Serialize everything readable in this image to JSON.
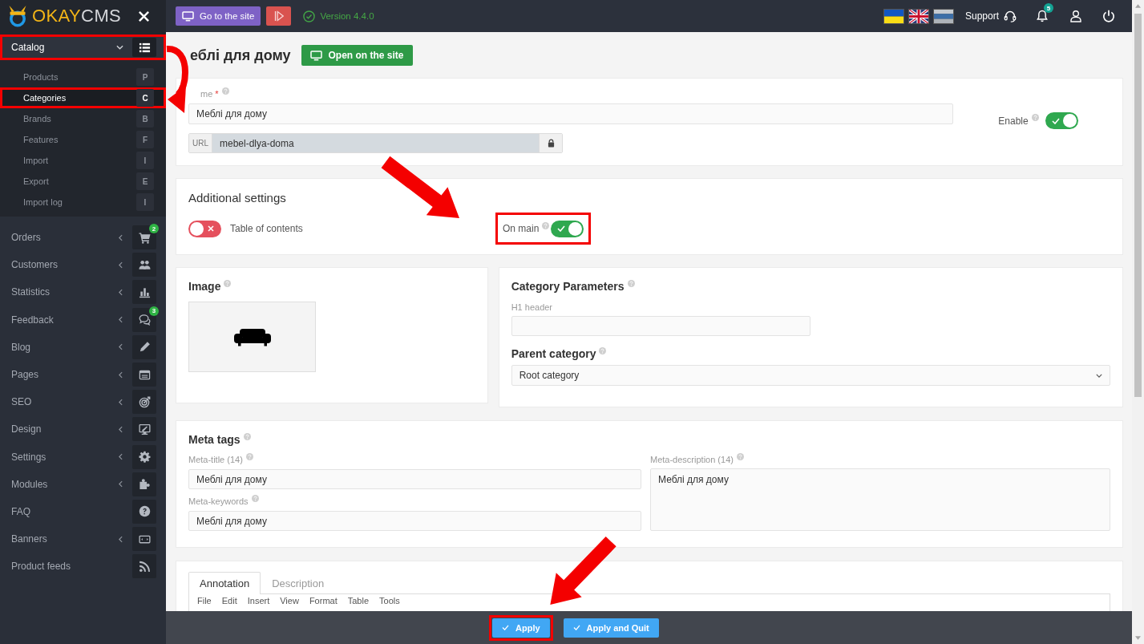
{
  "sidebar": {
    "logo": {
      "accent": "OKAY",
      "rest": "CMS"
    },
    "menu": [
      {
        "label": "Catalog",
        "kind": "group",
        "expanded": true,
        "highlighted": true,
        "children": [
          {
            "label": "Products",
            "shortcut": "P",
            "selected": false,
            "highlighted": false
          },
          {
            "label": "Categories",
            "shortcut": "C",
            "selected": true,
            "highlighted": true
          },
          {
            "label": "Brands",
            "shortcut": "B",
            "selected": false,
            "highlighted": false
          },
          {
            "label": "Features",
            "shortcut": "F",
            "selected": false,
            "highlighted": false
          },
          {
            "label": "Import",
            "shortcut": "I",
            "selected": false,
            "highlighted": false
          },
          {
            "label": "Export",
            "shortcut": "E",
            "selected": false,
            "highlighted": false
          },
          {
            "label": "Import log",
            "shortcut": "I",
            "selected": false,
            "highlighted": false
          }
        ]
      },
      {
        "label": "Orders",
        "kind": "group",
        "expanded": false,
        "highlighted": false,
        "badge": "2"
      },
      {
        "label": "Customers",
        "kind": "group",
        "expanded": false,
        "highlighted": false
      },
      {
        "label": "Statistics",
        "kind": "group",
        "expanded": false,
        "highlighted": false
      },
      {
        "label": "Feedback",
        "kind": "group",
        "expanded": false,
        "highlighted": false,
        "badge": "3"
      },
      {
        "label": "Blog",
        "kind": "group",
        "expanded": false,
        "highlighted": false
      },
      {
        "label": "Pages",
        "kind": "group",
        "expanded": false,
        "highlighted": false
      },
      {
        "label": "SEO",
        "kind": "group",
        "expanded": false,
        "highlighted": false
      },
      {
        "label": "Design",
        "kind": "group",
        "expanded": false,
        "highlighted": false
      },
      {
        "label": "Settings",
        "kind": "group",
        "expanded": false,
        "highlighted": false
      },
      {
        "label": "Modules",
        "kind": "group",
        "expanded": false,
        "highlighted": false
      },
      {
        "label": "FAQ",
        "kind": "link",
        "highlighted": false
      },
      {
        "label": "Banners",
        "kind": "group",
        "expanded": false,
        "highlighted": false
      },
      {
        "label": "Product feeds",
        "kind": "link",
        "highlighted": false
      }
    ]
  },
  "topbar": {
    "site_button": "Go to the site",
    "version": "Version 4.4.0",
    "support": "Support",
    "notification_count": "5"
  },
  "page": {
    "title": "еблі для дому",
    "open_button": "Open on the site"
  },
  "general": {
    "name_label": "me",
    "required_mark": "*",
    "name_value": "Меблі для дому",
    "url_prefix": "URL",
    "url_value": "mebel-dlya-doma",
    "enable_label": "Enable",
    "enabled": true
  },
  "additional_settings": {
    "title": "Additional settings",
    "toggles": [
      {
        "label": "Table of contents",
        "kind": "switch_label",
        "on": false,
        "highlighted": false
      },
      {
        "label": "On main",
        "kind": "label_switch",
        "on": true,
        "highlighted": true
      }
    ]
  },
  "image": {
    "title": "Image"
  },
  "category_parameters": {
    "title": "Category Parameters",
    "h1_label": "H1 header",
    "parent_title": "Parent category",
    "parent_value": "Root category"
  },
  "meta_tags": {
    "title": "Meta tags",
    "title_label": "Meta-title (14)",
    "title_value": "Меблі для дому",
    "keywords_label": "Meta-keywords",
    "keywords_value": "Меблі для дому",
    "description_label": "Meta-description (14)",
    "description_value": "Меблі для дому"
  },
  "editor": {
    "tabs": [
      {
        "label": "Annotation",
        "selected": true
      },
      {
        "label": "Description",
        "selected": false
      }
    ],
    "menu": [
      "File",
      "Edit",
      "Insert",
      "View",
      "Format",
      "Table",
      "Tools"
    ]
  },
  "actions": [
    {
      "label": "Apply",
      "highlighted": true
    },
    {
      "label": "Apply and Quit",
      "highlighted": false
    }
  ]
}
